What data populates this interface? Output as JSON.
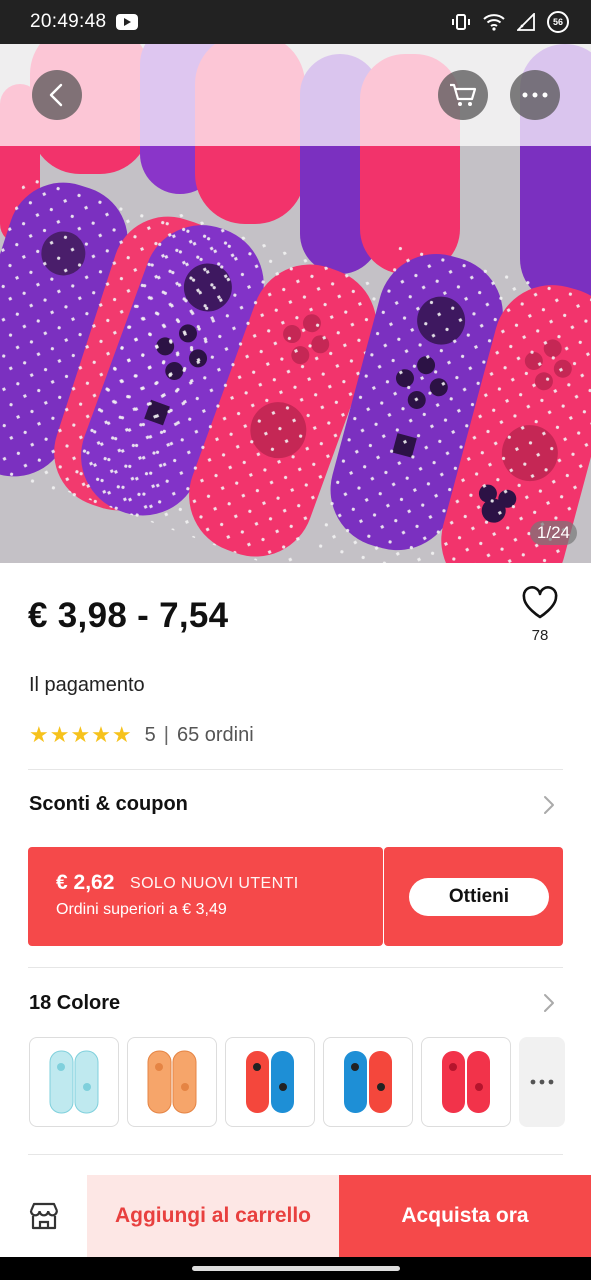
{
  "status_bar": {
    "time": "20:49:48",
    "network_badge": "56"
  },
  "hero": {
    "image_counter": "1/24"
  },
  "product": {
    "price": "€ 3,98 - 7,54",
    "wishlist_count": "78",
    "payment_label": "Il pagamento",
    "rating": "5",
    "rating_separator": "|",
    "orders": "65 ordini"
  },
  "discounts": {
    "title": "Sconti & coupon",
    "coupon": {
      "amount": "€ 2,62",
      "tag": "SOLO NUOVI UTENTI",
      "condition": "Ordini superiori a € 3,49",
      "button": "Ottieni"
    }
  },
  "colors": {
    "title": "18 Colore",
    "swatches": [
      {
        "name": "clear-blue",
        "left": "#bfe9ef",
        "right": "#bfe9ef"
      },
      {
        "name": "clear-orange",
        "left": "#f6a56a",
        "right": "#f6a56a"
      },
      {
        "name": "red-blue",
        "left": "#f4473c",
        "right": "#1e8fd6"
      },
      {
        "name": "blue-red",
        "left": "#1e8fd6",
        "right": "#f4473c"
      },
      {
        "name": "red-red",
        "left": "#f2334a",
        "right": "#f2334a"
      }
    ]
  },
  "bottom_bar": {
    "add_to_cart": "Aggiungi al carrello",
    "buy_now": "Acquista ora"
  },
  "theme": {
    "accent": "#f5494a",
    "star": "#f6c21c"
  },
  "icons": [
    "back-icon",
    "cart-icon",
    "more-icon",
    "heart-icon",
    "chevron-right-icon",
    "store-icon",
    "youtube-icon",
    "wifi-icon",
    "signal-icon",
    "vibrate-icon"
  ]
}
